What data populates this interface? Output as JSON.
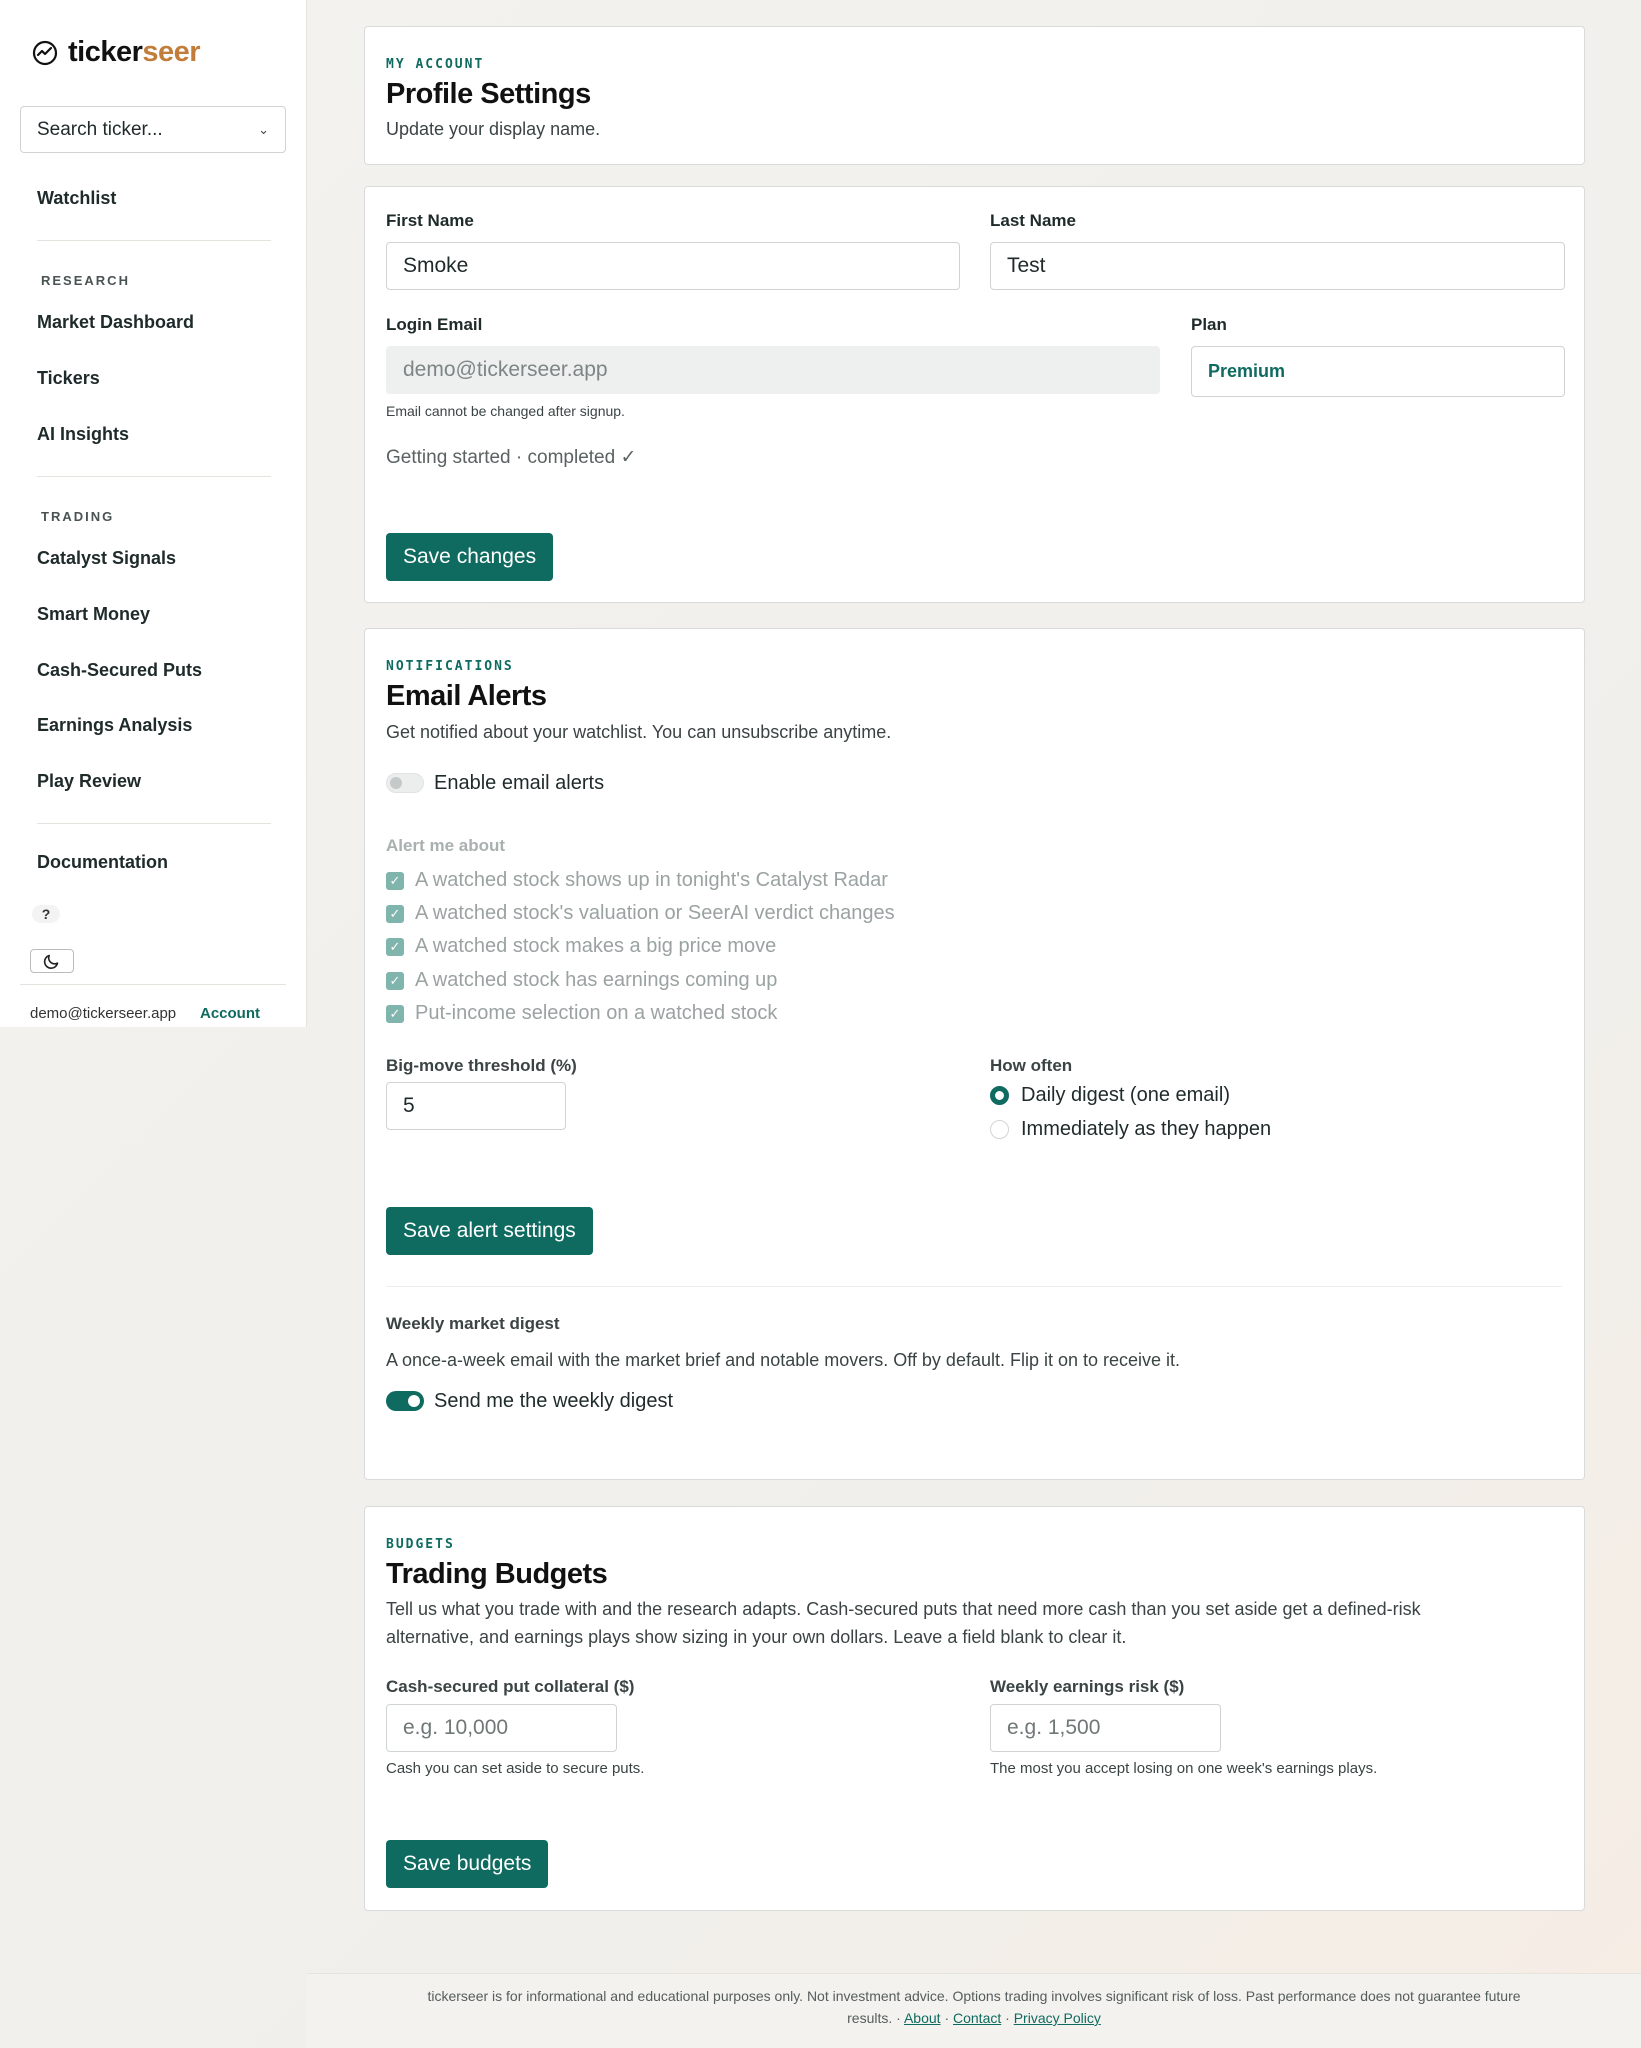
{
  "brand": {
    "name_main": "ticker",
    "name_accent": "seer"
  },
  "sidebar": {
    "search_label": "Search ticker...",
    "watchlist": "Watchlist",
    "research_heading": "RESEARCH",
    "research_items": [
      "Market Dashboard",
      "Tickers",
      "AI Insights"
    ],
    "trading_heading": "TRADING",
    "trading_items": [
      "Catalyst Signals",
      "Smart Money",
      "Cash-Secured Puts",
      "Earnings Analysis",
      "Play Review"
    ],
    "documentation": "Documentation",
    "help": "?",
    "email": "demo@tickerseer.app",
    "account": "Account"
  },
  "profile": {
    "eyebrow": "MY ACCOUNT",
    "title": "Profile Settings",
    "subtitle": "Update your display name."
  },
  "form": {
    "first_name_label": "First Name",
    "first_name_value": "Smoke",
    "last_name_label": "Last Name",
    "last_name_value": "Test",
    "email_label": "Login Email",
    "email_value": "demo@tickerseer.app",
    "email_hint": "Email cannot be changed after signup.",
    "plan_label": "Plan",
    "plan_value": "Premium",
    "status": "Getting started · completed ✓",
    "save_label": "Save changes"
  },
  "alerts": {
    "eyebrow": "NOTIFICATIONS",
    "title": "Email Alerts",
    "subtitle": "Get notified about your watchlist. You can unsubscribe anytime.",
    "enable_label": "Enable email alerts",
    "enable_on": false,
    "alert_me_label": "Alert me about",
    "options": [
      "A watched stock shows up in tonight's Catalyst Radar",
      "A watched stock's valuation or SeerAI verdict changes",
      "A watched stock makes a big price move",
      "A watched stock has earnings coming up",
      "Put-income selection on a watched stock"
    ],
    "threshold_label": "Big-move threshold (%)",
    "threshold_value": "5",
    "frequency_label": "How often",
    "frequency_options": [
      "Daily digest (one email)",
      "Immediately as they happen"
    ],
    "frequency_selected": "Daily digest (one email)",
    "save_label": "Save alert settings",
    "weekly_title": "Weekly market digest",
    "weekly_desc": "A once-a-week email with the market brief and notable movers. Off by default. Flip it on to receive it.",
    "weekly_toggle_label": "Send me the weekly digest",
    "weekly_on": true
  },
  "budgets": {
    "eyebrow": "BUDGETS",
    "title": "Trading Budgets",
    "description_line1": "Tell us what you trade with and the research adapts. Cash-secured puts that need more cash than you set aside get a defined-risk",
    "description_line2": "alternative, and earnings plays show sizing in your own dollars. Leave a field blank to clear it.",
    "collateral_label": "Cash-secured put collateral ($)",
    "collateral_placeholder": "e.g. 10,000",
    "collateral_hint": "Cash you can set aside to secure puts.",
    "risk_label": "Weekly earnings risk ($)",
    "risk_placeholder": "e.g. 1,500",
    "risk_hint": "The most you accept losing on one week's earnings plays.",
    "save_label": "Save budgets"
  },
  "footer": {
    "disclaimer_line1": "tickerseer is for informational and educational purposes only. Not investment advice. Options trading involves significant risk of loss. Past performance does not guarantee future",
    "disclaimer_line2": "results. ·",
    "about": "About",
    "contact": "Contact",
    "privacy": "Privacy Policy",
    "sep": "·"
  },
  "colors": {
    "accent": "#0f6b5f",
    "brand_accent": "#c27d3a"
  }
}
